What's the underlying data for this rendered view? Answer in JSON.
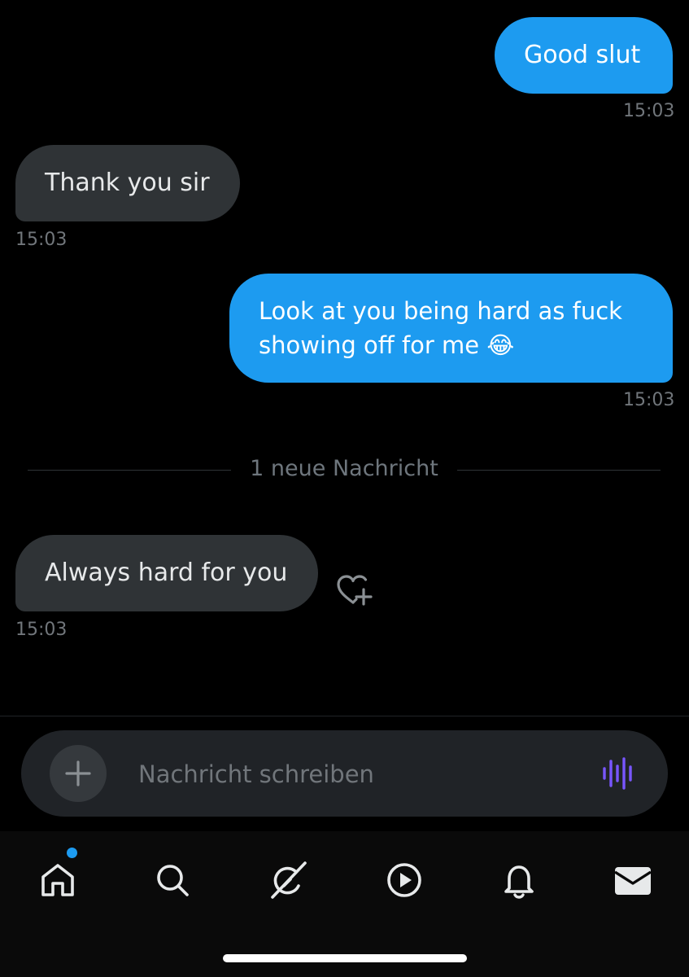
{
  "messages": [
    {
      "direction": "outgoing",
      "text": "Good slut",
      "time": "15:03"
    },
    {
      "direction": "incoming",
      "text": "Thank you sir",
      "time": "15:03"
    },
    {
      "direction": "outgoing",
      "lines": [
        "Look at you being hard as fuck",
        "showing off for me 😂"
      ],
      "time": "15:03"
    },
    {
      "direction": "incoming",
      "text": "Always hard for you",
      "time": "15:03"
    }
  ],
  "divider": {
    "label": "1 neue Nachricht"
  },
  "composer": {
    "placeholder": "Nachricht schreiben",
    "value": ""
  },
  "tabbar": {
    "items": [
      {
        "name": "home",
        "icon": "home-icon",
        "active": true,
        "has_unread_dot": true
      },
      {
        "name": "search",
        "icon": "search-icon"
      },
      {
        "name": "grok",
        "icon": "grok-icon"
      },
      {
        "name": "media",
        "icon": "play-icon"
      },
      {
        "name": "notifications",
        "icon": "bell-icon"
      },
      {
        "name": "messages",
        "icon": "mail-icon"
      }
    ]
  },
  "colors": {
    "background": "#000000",
    "outgoing_bubble": "#1d9bf0",
    "incoming_bubble": "#2f3336",
    "timestamp": "#71767b",
    "voice_icon": "#7856ff",
    "unread_dot": "#1d9bf0"
  }
}
